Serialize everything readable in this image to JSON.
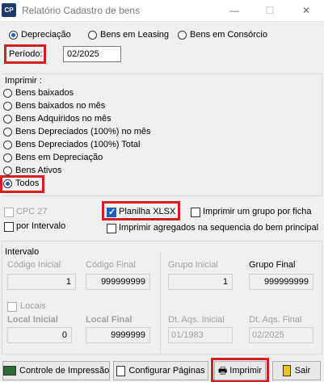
{
  "window": {
    "icon": "CP",
    "title": "Relatório Cadastro de bens",
    "min": "—",
    "max": "☐",
    "close": "✕"
  },
  "tipo": {
    "options": [
      "Depreciação",
      "Bens em Leasing",
      "Bens em Consórcio"
    ],
    "selected": "Depreciação"
  },
  "periodo": {
    "label": "Período:",
    "value": "02/2025"
  },
  "imprimir": {
    "label": "Imprimir :",
    "options": [
      "Bens baixados",
      "Bens baixados no mês",
      "Bens Adquiridos no mês",
      "Bens Depreciados (100%) no mês",
      "Bens Depreciados (100%) Total",
      "Bens em Depreciação",
      "Bens Ativos",
      "Todos"
    ],
    "selected": "Todos"
  },
  "opcoes": {
    "cpc27": {
      "label": "CPC 27",
      "checked": false,
      "enabled": false
    },
    "por_intervalo": {
      "label": "por Intervalo",
      "checked": false
    },
    "planilha": {
      "label": "Planilha XLSX",
      "checked": true
    },
    "grupo_ficha": {
      "label": "Imprimir um grupo por ficha",
      "checked": false
    },
    "agregados": {
      "label": "Imprimir agregados na sequencia do bem principal",
      "checked": false
    }
  },
  "intervalo": {
    "label": "Intervalo",
    "codigo_inicial": {
      "label": "Código Inicial",
      "value": "1"
    },
    "codigo_final": {
      "label": "Código Final",
      "value": "999999999"
    },
    "grupo_inicial": {
      "label": "Grupo Inicial",
      "value": "1"
    },
    "grupo_final": {
      "label": "Grupo Final",
      "value": "999999999"
    },
    "locais": {
      "label": "Locais",
      "checked": false
    },
    "local_inicial": {
      "label": "Local Inicial",
      "value": "0"
    },
    "local_final": {
      "label": "Local Final",
      "value": "9999999"
    },
    "dt_aqs_inicial": {
      "label": "Dt. Aqs. Inicial",
      "value": "01/1983"
    },
    "dt_aqs_final": {
      "label": "Dt. Aqs. Final",
      "value": "02/2025"
    }
  },
  "buttons": {
    "controle": "Controle de Impressão",
    "configurar": "Configurar Páginas",
    "imprimir": "Imprimir",
    "sair": "Sair"
  }
}
